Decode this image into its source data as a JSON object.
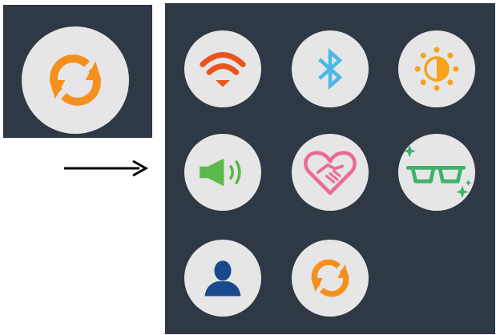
{
  "colors": {
    "panel_background": "#2f3845",
    "circle_background": "#e6e6e6",
    "sync_orange": "#f5901e",
    "wifi_red_orange": "#e9551f",
    "bluetooth_blue": "#4cb8e8",
    "brightness_orange": "#f6a21b",
    "volume_green": "#5bb84a",
    "heart_pink": "#ec6a96",
    "glasses_green": "#3db36a",
    "user_navy": "#1a4a8e",
    "arrow_black": "#000000"
  },
  "preview": {
    "icon": "sync-icon"
  },
  "transition": {
    "icon": "right-arrow-icon"
  },
  "grid": {
    "tiles": [
      {
        "name": "wifi",
        "icon": "wifi-icon"
      },
      {
        "name": "bluetooth",
        "icon": "bluetooth-icon"
      },
      {
        "name": "brightness",
        "icon": "brightness-icon"
      },
      {
        "name": "volume",
        "icon": "volume-icon"
      },
      {
        "name": "heart",
        "icon": "heart-handshake-icon"
      },
      {
        "name": "glasses",
        "icon": "sparkle-glasses-icon"
      },
      {
        "name": "user",
        "icon": "user-icon"
      },
      {
        "name": "sync",
        "icon": "sync-icon"
      }
    ]
  }
}
